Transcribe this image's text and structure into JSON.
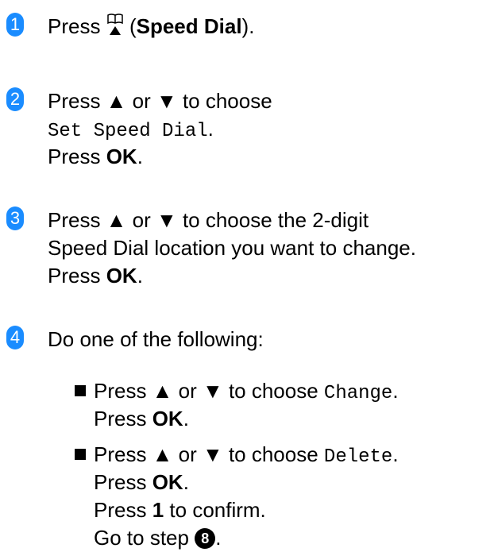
{
  "steps": [
    {
      "number": "1",
      "text_press": "Press",
      "speed_dial_label": "Speed Dial",
      "open_paren": "(",
      "close_paren": ").",
      "icon": "speed-dial-book-icon"
    },
    {
      "number": "2",
      "line1": "Press ▲ or ▼ to choose",
      "menu_item": "Set Speed Dial",
      "menu_period": ".",
      "press_ok_prefix": "Press",
      "ok": "OK",
      "ok_period": "."
    },
    {
      "number": "3",
      "line1": "Press ▲ or ▼ to choose the 2-digit",
      "line2": "Speed Dial location you want to change.",
      "press_ok_prefix": "Press",
      "ok": "OK",
      "ok_period": "."
    },
    {
      "number": "4",
      "line1": "Do one of the following:",
      "bullets": [
        {
          "prefix": "Press ▲ or ▼ to choose",
          "menu_item": "Change",
          "menu_period": ".",
          "press_ok_prefix": "Press",
          "ok": "OK",
          "ok_period": "."
        },
        {
          "prefix": "Press ▲ or ▼ to choose",
          "menu_item": "Delete",
          "menu_period": ".",
          "press_ok_prefix": "Press",
          "ok": "OK",
          "ok_period": ".",
          "confirm_prefix": "Press",
          "confirm_key": "1",
          "confirm_suffix": "to confirm.",
          "goto_prefix": "Go to step",
          "goto_step": "8",
          "goto_period": "."
        }
      ]
    }
  ],
  "colors": {
    "step_badge": "#1a8cff",
    "bullet": "#000000"
  }
}
